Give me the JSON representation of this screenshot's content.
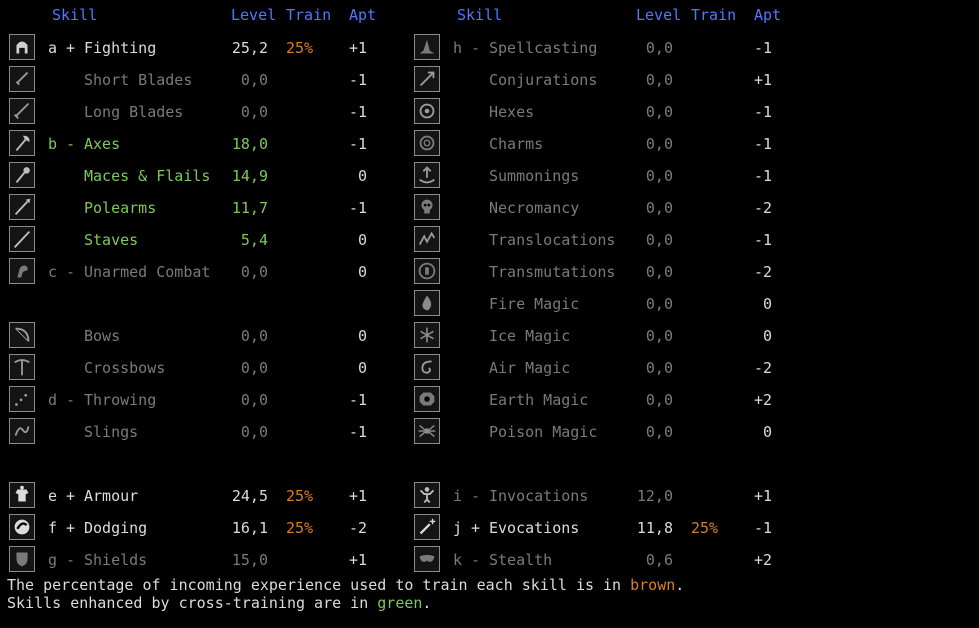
{
  "header": {
    "skill": "Skill",
    "level": "Level",
    "train": "Train",
    "apt": "Apt"
  },
  "colors": {
    "header": "#4f78ff",
    "normal": "#dcdcdc",
    "untrained": "#7a7a7a",
    "cross_trained": "#7ec85c",
    "train_pct": "#d7802a"
  },
  "left": [
    {
      "row": 1,
      "icon": "helmet-icon",
      "letter": "a",
      "mark": "+",
      "name": "Fighting",
      "level": "25,2",
      "train": "25%",
      "apt": "+1",
      "color": "white"
    },
    {
      "row": 2,
      "icon": "dagger-icon",
      "letter": "",
      "mark": "",
      "name": "Short Blades",
      "level": "0,0",
      "train": "",
      "apt": "-1",
      "color": "grey"
    },
    {
      "row": 3,
      "icon": "sword-icon",
      "letter": "",
      "mark": "",
      "name": "Long Blades",
      "level": "0,0",
      "train": "",
      "apt": "-1",
      "color": "grey"
    },
    {
      "row": 4,
      "icon": "axe-icon",
      "letter": "b",
      "mark": "-",
      "name": "Axes",
      "level": "18,0",
      "train": "",
      "apt": "-1",
      "color": "green"
    },
    {
      "row": 5,
      "icon": "mace-icon",
      "letter": "",
      "mark": "",
      "name": "Maces & Flails",
      "level": "14,9",
      "train": "",
      "apt": "0",
      "color": "green"
    },
    {
      "row": 6,
      "icon": "polearm-icon",
      "letter": "",
      "mark": "",
      "name": "Polearms",
      "level": "11,7",
      "train": "",
      "apt": "-1",
      "color": "green"
    },
    {
      "row": 7,
      "icon": "staff-icon",
      "letter": "",
      "mark": "",
      "name": "Staves",
      "level": "5,4",
      "train": "",
      "apt": "0",
      "color": "green"
    },
    {
      "row": 8,
      "icon": "fist-icon",
      "letter": "c",
      "mark": "-",
      "name": "Unarmed Combat",
      "level": "0,0",
      "train": "",
      "apt": "0",
      "color": "grey"
    },
    {
      "row": 10,
      "icon": "bow-icon",
      "letter": "",
      "mark": "",
      "name": "Bows",
      "level": "0,0",
      "train": "",
      "apt": "0",
      "color": "grey"
    },
    {
      "row": 11,
      "icon": "crossbow-icon",
      "letter": "",
      "mark": "",
      "name": "Crossbows",
      "level": "0,0",
      "train": "",
      "apt": "0",
      "color": "grey"
    },
    {
      "row": 12,
      "icon": "throwing-icon",
      "letter": "d",
      "mark": "-",
      "name": "Throwing",
      "level": "0,0",
      "train": "",
      "apt": "-1",
      "color": "grey"
    },
    {
      "row": 13,
      "icon": "sling-icon",
      "letter": "",
      "mark": "",
      "name": "Slings",
      "level": "0,0",
      "train": "",
      "apt": "-1",
      "color": "grey"
    },
    {
      "row": 15,
      "icon": "armour-icon",
      "letter": "e",
      "mark": "+",
      "name": "Armour",
      "level": "24,5",
      "train": "25%",
      "apt": "+1",
      "color": "white"
    },
    {
      "row": 16,
      "icon": "dodging-icon",
      "letter": "f",
      "mark": "+",
      "name": "Dodging",
      "level": "16,1",
      "train": "25%",
      "apt": "-2",
      "color": "white"
    },
    {
      "row": 17,
      "icon": "shield-icon",
      "letter": "g",
      "mark": "-",
      "name": "Shields",
      "level": "15,0",
      "train": "",
      "apt": "+1",
      "color": "grey"
    }
  ],
  "right": [
    {
      "row": 1,
      "icon": "wizard-hat-icon",
      "letter": "h",
      "mark": "-",
      "name": "Spellcasting",
      "level": "0,0",
      "train": "",
      "apt": "-1",
      "color": "grey"
    },
    {
      "row": 2,
      "icon": "magic-dart-icon",
      "letter": "",
      "mark": "",
      "name": "Conjurations",
      "level": "0,0",
      "train": "",
      "apt": "+1",
      "color": "grey"
    },
    {
      "row": 3,
      "icon": "hex-eye-icon",
      "letter": "",
      "mark": "",
      "name": "Hexes",
      "level": "0,0",
      "train": "",
      "apt": "-1",
      "color": "grey"
    },
    {
      "row": 4,
      "icon": "charm-icon",
      "letter": "",
      "mark": "",
      "name": "Charms",
      "level": "0,0",
      "train": "",
      "apt": "-1",
      "color": "grey"
    },
    {
      "row": 5,
      "icon": "summon-icon",
      "letter": "",
      "mark": "",
      "name": "Summonings",
      "level": "0,0",
      "train": "",
      "apt": "-1",
      "color": "grey"
    },
    {
      "row": 6,
      "icon": "skull-icon",
      "letter": "",
      "mark": "",
      "name": "Necromancy",
      "level": "0,0",
      "train": "",
      "apt": "-2",
      "color": "grey"
    },
    {
      "row": 7,
      "icon": "translocation-icon",
      "letter": "",
      "mark": "",
      "name": "Translocations",
      "level": "0,0",
      "train": "",
      "apt": "-1",
      "color": "grey"
    },
    {
      "row": 8,
      "icon": "transmutation-icon",
      "letter": "",
      "mark": "",
      "name": "Transmutations",
      "level": "0,0",
      "train": "",
      "apt": "-2",
      "color": "grey"
    },
    {
      "row": 9,
      "icon": "fire-icon",
      "letter": "",
      "mark": "",
      "name": "Fire Magic",
      "level": "0,0",
      "train": "",
      "apt": "0",
      "color": "grey"
    },
    {
      "row": 10,
      "icon": "snowflake-icon",
      "letter": "",
      "mark": "",
      "name": "Ice Magic",
      "level": "0,0",
      "train": "",
      "apt": "0",
      "color": "grey"
    },
    {
      "row": 11,
      "icon": "air-swirl-icon",
      "letter": "",
      "mark": "",
      "name": "Air Magic",
      "level": "0,0",
      "train": "",
      "apt": "-2",
      "color": "grey"
    },
    {
      "row": 12,
      "icon": "earth-icon",
      "letter": "",
      "mark": "",
      "name": "Earth Magic",
      "level": "0,0",
      "train": "",
      "apt": "+2",
      "color": "grey"
    },
    {
      "row": 13,
      "icon": "spider-icon",
      "letter": "",
      "mark": "",
      "name": "Poison Magic",
      "level": "0,0",
      "train": "",
      "apt": "0",
      "color": "grey"
    },
    {
      "row": 15,
      "icon": "invocation-icon",
      "letter": "i",
      "mark": "-",
      "name": "Invocations",
      "level": "12,0",
      "train": "",
      "apt": "+1",
      "color": "grey"
    },
    {
      "row": 16,
      "icon": "wand-icon",
      "letter": "j",
      "mark": "+",
      "name": "Evocations",
      "level": "11,8",
      "train": "25%",
      "apt": "-1",
      "color": "white"
    },
    {
      "row": 17,
      "icon": "mask-icon",
      "letter": "k",
      "mark": "-",
      "name": "Stealth",
      "level": "0,6",
      "train": "",
      "apt": "+2",
      "color": "grey"
    }
  ],
  "footer": {
    "line1_prefix": "The percentage of incoming experience used to train each skill is in ",
    "line1_word": "brown",
    "line1_suffix": ".",
    "line2_prefix": "Skills enhanced by cross-training are in ",
    "line2_word": "green",
    "line2_suffix": "."
  }
}
